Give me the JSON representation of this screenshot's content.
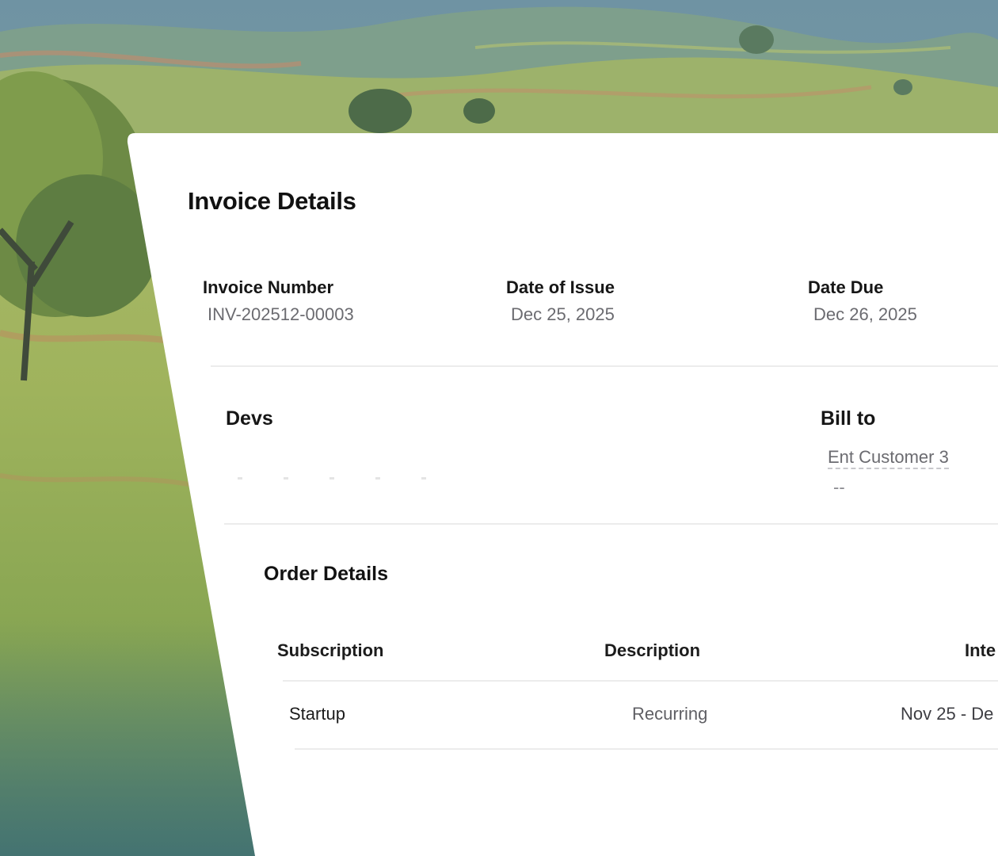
{
  "invoice": {
    "title": "Invoice Details",
    "fields": [
      {
        "label": "Invoice Number",
        "value": "INV-202512-00003"
      },
      {
        "label": "Date of Issue",
        "value": "Dec 25, 2025"
      },
      {
        "label": "Date Due",
        "value": "Dec 26, 2025"
      }
    ]
  },
  "from": {
    "name": "Devs"
  },
  "bill_to": {
    "heading": "Bill to",
    "customer": "Ent Customer 3",
    "detail": "--"
  },
  "order": {
    "heading": "Order Details",
    "columns": [
      "Subscription",
      "Description",
      "Inte"
    ],
    "rows": [
      {
        "subscription": "Startup",
        "description": "Recurring",
        "interval": "Nov 25 - De"
      }
    ]
  }
}
